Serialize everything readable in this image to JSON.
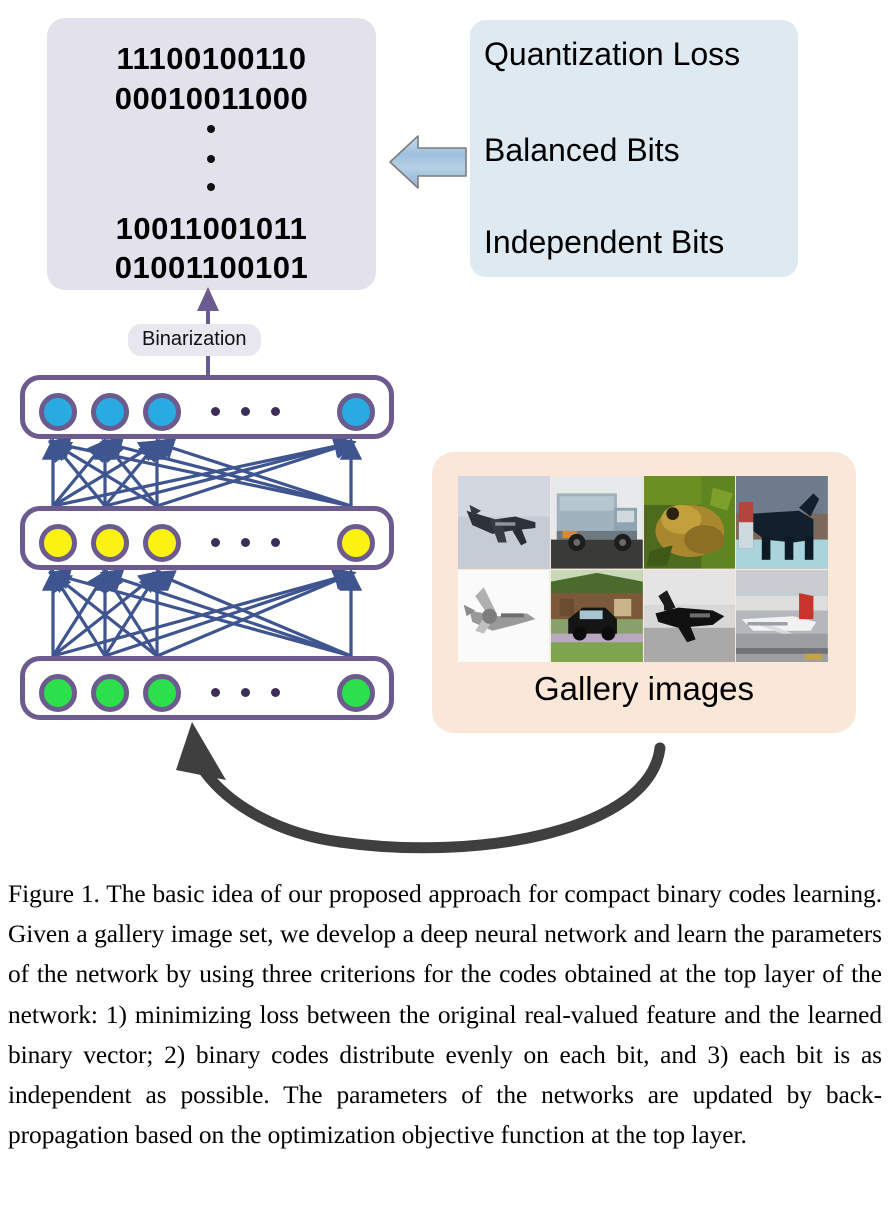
{
  "figure": {
    "binary_panel": {
      "name": "binary codes",
      "lines": [
        "11100100110",
        "00010011000",
        "10011001011",
        "01001100101"
      ],
      "vertical_ellipsis": "•",
      "background_color": "#e3e1ec"
    },
    "criteria_panel": {
      "background_color": "#dee9f2",
      "items": [
        "Quantization Loss",
        "Balanced Bits",
        "Independent Bits"
      ]
    },
    "block_arrow": {
      "direction": "left",
      "fill_color": "#aac7e0",
      "stroke_color": "#7a7a7a"
    },
    "binarization": {
      "label": "Binarization",
      "pill_color": "#e8e6ef",
      "arrow_color": "#6b5b8e"
    },
    "network": {
      "box_stroke_color": "#6b5b8e",
      "connection_color": "#3f5590",
      "layers": [
        {
          "id": "output",
          "node_color": "#29abe2",
          "node_count_visible": 4,
          "ellipsis_dots": 3
        },
        {
          "id": "hidden",
          "node_color": "#fcf211",
          "node_count_visible": 4,
          "ellipsis_dots": 3
        },
        {
          "id": "input",
          "node_color": "#2be04a",
          "node_count_visible": 4,
          "ellipsis_dots": 3
        }
      ]
    },
    "gallery_panel": {
      "label": "Gallery images",
      "background_color": "#fae7d8",
      "thumbnails": [
        "airplane-dark-sky",
        "garbage-truck",
        "frog-on-moss",
        "horse-dark-blue"
      ],
      "thumbnails_row2": [
        "airplane-grayscale",
        "car-by-house",
        "airplane-silhouette-gray",
        "airliner-on-tarmac"
      ]
    },
    "feedback_arrow": {
      "color": "#3f3f3f",
      "description": "curved arrow from gallery back to input layer"
    }
  },
  "caption": {
    "text": "Figure 1. The basic idea of our proposed approach for compact binary codes learning. Given a gallery image set, we develop a deep neural network and learn the parameters of the network by using three criterions for the codes obtained at the top layer of the network: 1) minimizing loss between the original real-valued feature and the learned binary vector; 2) binary codes distribute evenly on each bit, and 3) each bit is as independent as possible. The parameters of the networks are updated by back-propagation based on the optimization objective function at the top layer."
  }
}
